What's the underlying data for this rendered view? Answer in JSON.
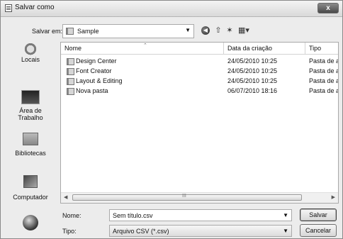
{
  "window": {
    "title": "Salvar como",
    "close_label": "x"
  },
  "toolbar": {
    "save_in_label": "Salvar em:",
    "location": "Sample",
    "icons": [
      "back-icon",
      "up-folder-icon",
      "new-folder-icon",
      "views-menu-icon"
    ]
  },
  "places": [
    {
      "label": "Locais",
      "icon": "recent-places-icon"
    },
    {
      "label": "Área de\nTrabalho",
      "icon": "desktop-icon"
    },
    {
      "label": "Bibliotecas",
      "icon": "libraries-icon"
    },
    {
      "label": "Computador",
      "icon": "computer-icon"
    },
    {
      "label": "",
      "icon": "network-icon"
    }
  ],
  "filelist": {
    "columns": [
      "Nome",
      "Data da criação",
      "Tipo"
    ],
    "rows": [
      {
        "name": "Design Center",
        "date": "24/05/2010 10:25",
        "type": "Pasta de ar"
      },
      {
        "name": "Font Creator",
        "date": "24/05/2010 10:25",
        "type": "Pasta de ar"
      },
      {
        "name": "Layout & Editing",
        "date": "24/05/2010 10:25",
        "type": "Pasta de ar"
      },
      {
        "name": "Nova pasta",
        "date": "06/07/2010 18:16",
        "type": "Pasta de ar"
      }
    ],
    "scroll_grip": "III"
  },
  "form": {
    "name_label": "Nome:",
    "name_value": "Sem título.csv",
    "type_label": "Tipo:",
    "type_value": "Arquivo CSV (*.csv)",
    "save_button": "Salvar",
    "cancel_button": "Cancelar"
  }
}
